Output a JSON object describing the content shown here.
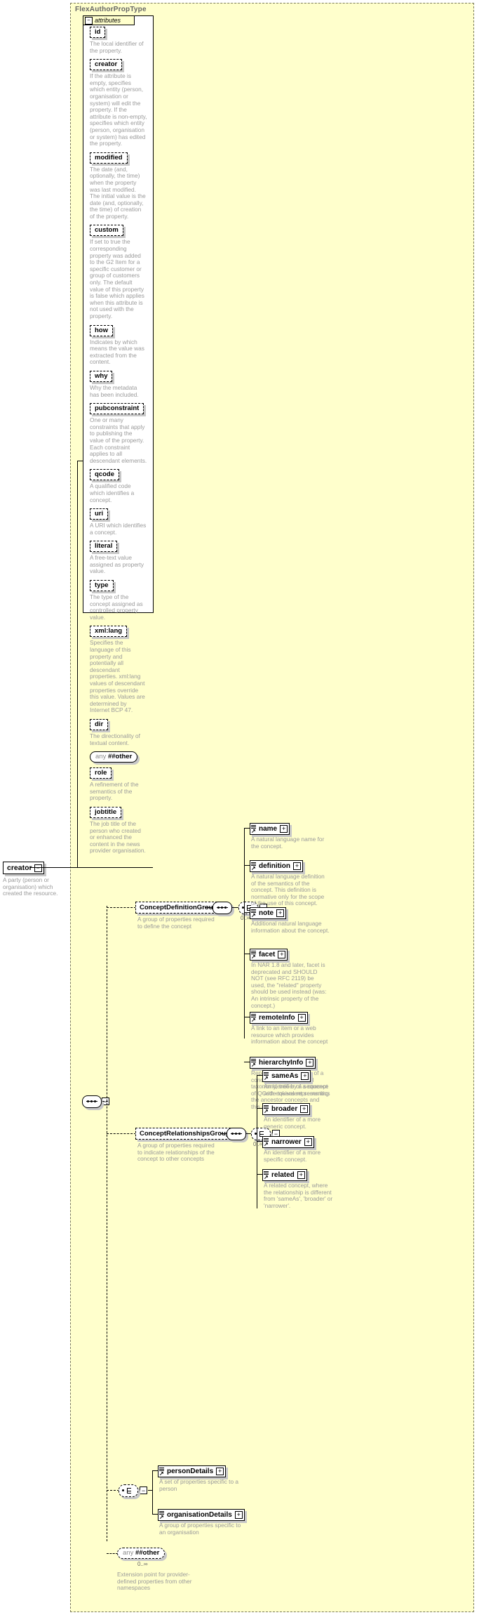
{
  "diagram": {
    "kind": "xsd-schema-documentation",
    "type_name": "FlexAuthorPropType",
    "attributes_label": "attributes",
    "root_element": {
      "name": "creator",
      "description": "A party (person or organisation) which created the resource."
    },
    "attributes": [
      {
        "name": "id",
        "description": "The local identifier of the property."
      },
      {
        "name": "creator",
        "description": "If the attribute is empty, specifies which entity (person, organisation or system) will edit the property. If the attribute is non-empty, specifies which entity (person, organisation or system) has edited the property."
      },
      {
        "name": "modified",
        "description": "The date (and, optionally, the time) when the property was last modified. The initial value is the date (and, optionally, the time) of creation of the property."
      },
      {
        "name": "custom",
        "description": "If set to true the corresponding property was added to the G2 Item for a specific customer or group of customers only. The default value of this property is false which applies when this attribute is not used with the property."
      },
      {
        "name": "how",
        "description": "Indicates by which means the value was extracted from the content."
      },
      {
        "name": "why",
        "description": "Why the metadata has been included."
      },
      {
        "name": "pubconstraint",
        "description": "One or many constraints that apply to publishing the value of the property. Each constraint applies to all descendant elements."
      },
      {
        "name": "qcode",
        "description": "A qualified code which identifies a concept."
      },
      {
        "name": "uri",
        "description": "A URI which identifies a concept."
      },
      {
        "name": "literal",
        "description": "A free-text value assigned as property value."
      },
      {
        "name": "type",
        "description": "The type of the concept assigned as controlled property value."
      },
      {
        "name": "xml:lang",
        "description": "Specifies the language of this property and potentially all descendant properties. xml:lang values of descendant properties override this value. Values are determined by Internet BCP 47."
      },
      {
        "name": "dir",
        "description": "The directionality of textual content."
      },
      {
        "name": "any",
        "namespace": "##other",
        "is_any": true,
        "description": ""
      },
      {
        "name": "role",
        "description": "A refinement of the semantics of the property."
      },
      {
        "name": "jobtitle",
        "description": "The job title of the person who created or enhanced the content in the news provider organisation."
      }
    ],
    "groups": [
      {
        "name": "ConceptDefinitionGroup",
        "description": "A group of properties required to define the concept",
        "occurs": "0..∞",
        "children": [
          {
            "name": "name",
            "description": "A natural language name for the concept."
          },
          {
            "name": "definition",
            "description": "A natural language definition of the semantics of the concept. This definition is normative only for the scope of the use of this concept."
          },
          {
            "name": "note",
            "description": "Additional natural language information about the concept."
          },
          {
            "name": "facet",
            "description": "In NAR 1.8 and later, facet is deprecated and SHOULD NOT (see RFC 2119) be used, the \"related\" property should be used instead (was: An intrinsic property of the concept.)"
          },
          {
            "name": "remoteInfo",
            "description": "A link to an item or a web resource which provides information about the concept"
          },
          {
            "name": "hierarchyInfo",
            "description": "Represents the position of a concept in a hierarchical taxonomy, tree by a sequence of QCode tokens representing the ancestor concepts and this concept"
          }
        ]
      },
      {
        "name": "ConceptRelationshipsGroup",
        "description": "A group of properties required to indicate relationships of the concept to other concepts",
        "occurs": "0..∞",
        "children": [
          {
            "name": "sameAs",
            "description": "An identifier of a concept with equivalent semantics"
          },
          {
            "name": "broader",
            "description": "An identifier of a more generic concept."
          },
          {
            "name": "narrower",
            "description": "An identifier of a more specific concept."
          },
          {
            "name": "related",
            "description": "A related concept, where the relationship is different from 'sameAs', 'broader' or 'narrower'."
          }
        ]
      }
    ],
    "detail_choice": [
      {
        "name": "personDetails",
        "description": "A set of properties specific to a person"
      },
      {
        "name": "organisationDetails",
        "description": "A group of properties specific to an organisation"
      }
    ],
    "extension": {
      "name": "any",
      "namespace": "##other",
      "occurs": "0..∞",
      "description": "Extension point for provider-defined properties from other namespaces"
    },
    "glyphs": {
      "expand": "+",
      "collapse": "−",
      "element_link_arrow": "↗"
    },
    "colors": {
      "type_background": "#ffffcc",
      "panel_background": "#ffffff",
      "description_text": "#9a9a9a",
      "title_text": "#666666",
      "shadow": "#c8c8c8",
      "border": "#000000"
    }
  }
}
